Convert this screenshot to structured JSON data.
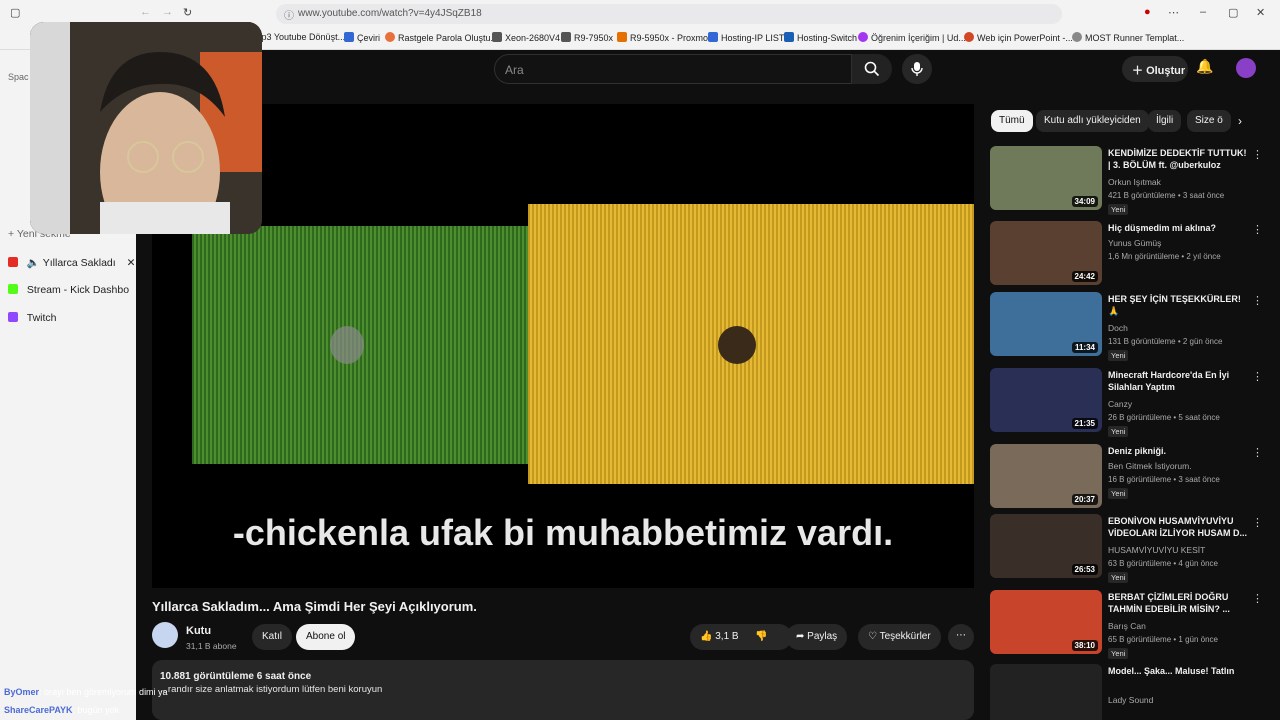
{
  "browser": {
    "url": "www.youtube.com/watch?v=4y4JSqZB18",
    "bookmarks": [
      "Mp3 Youtube Dönüşt...",
      "Çeviri",
      "Rastgele Parola Oluştu...",
      "Xeon-2680V4",
      "R9-7950x",
      "R9-5950x - Proxmox",
      "Hosting-IP LIST",
      "Hosting-Switch",
      "Öğrenim İçeriğim | Ud...",
      "Web için PowerPoint -...",
      "MOST Runner Templat..."
    ]
  },
  "sidebar": {
    "new_tab": "Yeni sekme",
    "tabs": [
      {
        "label": "Yıllarca Sakladı",
        "color": "#e52d27"
      },
      {
        "label": "Stream - Kick Dashbo",
        "color": "#53fc18"
      },
      {
        "label": "Twitch",
        "color": "#9146ff"
      }
    ],
    "space_label": "Spac"
  },
  "youtube": {
    "search_placeholder": "Ara",
    "create_label": "Oluştur",
    "video": {
      "caption": "-chickenla ufak bi muhabbetimiz vardı.",
      "title": "Yıllarca Sakladım... Ama Şimdi Her Şeyi Açıklıyorum."
    },
    "channel": {
      "name": "Kutu",
      "subs": "31,1 B abone",
      "join": "Katıl",
      "subscribe": "Abone ol"
    },
    "actions": {
      "likes": "3,1 B",
      "share": "Paylaş",
      "thanks": "Teşekkürler"
    },
    "description": {
      "views": "10.881 görüntüleme  6 saat önce",
      "text": "...randır size anlatmak istiyordum lütfen beni koruyun"
    },
    "chips": [
      "Tümü",
      "Kutu adlı yükleyiciden",
      "İlgili",
      "Size ö"
    ],
    "recommendations": [
      {
        "title": "KENDİMİZE DEDEKTİF TUTTUK! | 3. BÖLÜM ft. @uberkuloz",
        "channel": "Orkun Işıtmak",
        "meta": "421 B görüntüleme • 3 saat önce",
        "badge": "Yeni",
        "duration": "34:09",
        "thumb": "#6f7a5a"
      },
      {
        "title": "Hiç düşmedim mi aklına?",
        "channel": "Yunus Gümüş",
        "meta": "1,6 Mn görüntüleme • 2 yıl önce",
        "badge": "",
        "duration": "24:42",
        "thumb": "#5a4030"
      },
      {
        "title": "HER ŞEY İÇİN TEŞEKKÜRLER! 🙏",
        "channel": "Doch",
        "meta": "131 B görüntüleme • 2 gün önce",
        "badge": "Yeni",
        "duration": "11:34",
        "thumb": "#3d6f9a"
      },
      {
        "title": "Minecraft Hardcore'da En İyi Silahları Yaptım",
        "channel": "Canzy",
        "meta": "26 B görüntüleme • 5 saat önce",
        "badge": "Yeni",
        "duration": "21:35",
        "thumb": "#2a2f55"
      },
      {
        "title": "Deniz pikniği.",
        "channel": "Ben Gitmek İstiyorum.",
        "meta": "16 B görüntüleme • 3 saat önce",
        "badge": "Yeni",
        "duration": "20:37",
        "thumb": "#7a6a5a"
      },
      {
        "title": "EBONİVON HUSAMVİYUVİYU VİDEOLARI İZLİYOR HUSAM D...",
        "channel": "HUSAMVİYUVİYU KESİT",
        "meta": "63 B görüntüleme • 4 gün önce",
        "badge": "Yeni",
        "duration": "26:53",
        "thumb": "#3a2e28"
      },
      {
        "title": "BERBAT ÇİZİMLERİ DOĞRU TAHMİN EDEBİLİR MİSİN? ...",
        "channel": "Barış Can",
        "meta": "65 B görüntüleme • 1 gün önce",
        "badge": "Yeni",
        "duration": "38:10",
        "thumb": "#c8452c"
      },
      {
        "title": "Model... Şaka... Maluse! Tatlın",
        "channel": "Lady Sound",
        "meta": "",
        "badge": "",
        "duration": "",
        "thumb": "#222"
      }
    ]
  },
  "chat": [
    {
      "user": "ByOmer",
      "text": ": orayı ben göremiyorum dimi ya"
    },
    {
      "user": "ShareCarePAYK",
      "text": ": bugün yok"
    }
  ]
}
